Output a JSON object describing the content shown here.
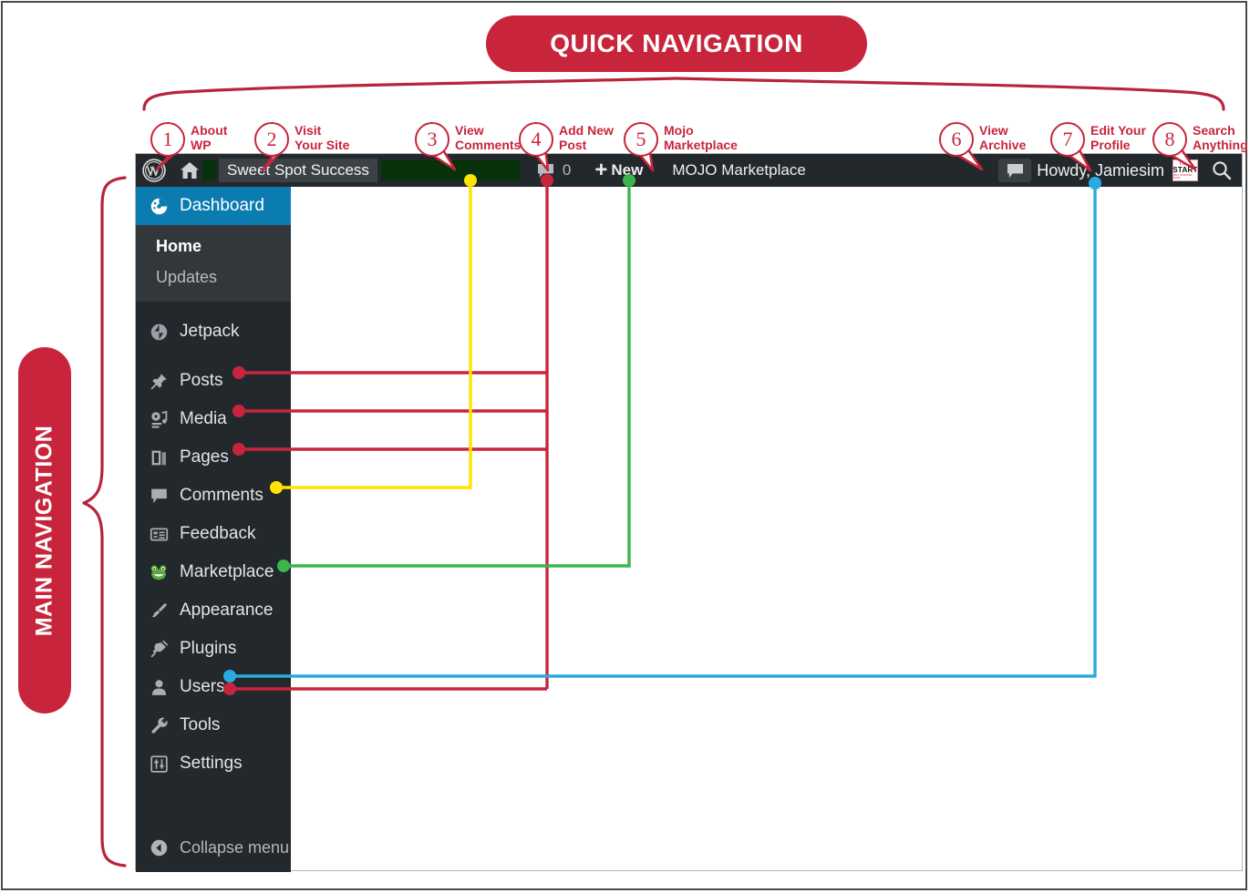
{
  "banners": {
    "quick_navigation": "QUICK NAVIGATION",
    "main_navigation": "MAIN NAVIGATION"
  },
  "colors": {
    "accent_red": "#c8253c",
    "admin_bar_bg": "#23282d",
    "sidebar_bg": "#23282d",
    "active_menu_blue": "#0b7cb0",
    "submenu_bg": "#32373c",
    "line_red": "#c8253c",
    "line_yellow": "#ffe400",
    "line_green": "#3cb54a",
    "line_blue": "#29abe2"
  },
  "callouts": [
    {
      "num": "1",
      "line1": "About",
      "line2": "WP"
    },
    {
      "num": "2",
      "line1": "Visit",
      "line2": "Your Site"
    },
    {
      "num": "3",
      "line1": "View",
      "line2": "Comments"
    },
    {
      "num": "4",
      "line1": "Add New",
      "line2": "Post"
    },
    {
      "num": "5",
      "line1": "Mojo",
      "line2": "Marketplace"
    },
    {
      "num": "6",
      "line1": "View",
      "line2": "Archive"
    },
    {
      "num": "7",
      "line1": "Edit Your",
      "line2": "Profile"
    },
    {
      "num": "8",
      "line1": "Search",
      "line2": "Anything"
    }
  ],
  "admin_bar": {
    "wp_logo_icon": "wordpress-logo-icon",
    "home_icon": "home-icon",
    "site_name": "Sweet Spot Success",
    "comments_icon": "comment-bubble-icon",
    "comments_count": "0",
    "new_plus_icon": "plus-icon",
    "new_label": "New",
    "mojo_label": "MOJO Marketplace",
    "archive_icon": "archive-bubble-icon",
    "howdy_label": "Howdy, Jamiesim",
    "start_logo": {
      "line1": "Click",
      "line2": "START",
      "line3": "GET STARTED NOW"
    },
    "search_icon": "search-icon"
  },
  "sidebar": {
    "items": [
      {
        "label": "Dashboard",
        "icon": "dashboard-icon",
        "active": true
      },
      {
        "label": "Jetpack",
        "icon": "jetpack-icon",
        "active": false
      },
      {
        "label": "Posts",
        "icon": "pin-icon",
        "active": false
      },
      {
        "label": "Media",
        "icon": "media-icon",
        "active": false
      },
      {
        "label": "Pages",
        "icon": "pages-icon",
        "active": false
      },
      {
        "label": "Comments",
        "icon": "comment-bubble-icon",
        "active": false
      },
      {
        "label": "Feedback",
        "icon": "feedback-icon",
        "active": false
      },
      {
        "label": "Marketplace",
        "icon": "mojo-frog-icon",
        "active": false
      },
      {
        "label": "Appearance",
        "icon": "paintbrush-icon",
        "active": false
      },
      {
        "label": "Plugins",
        "icon": "plug-icon",
        "active": false
      },
      {
        "label": "Users",
        "icon": "user-icon",
        "active": false
      },
      {
        "label": "Tools",
        "icon": "wrench-icon",
        "active": false
      },
      {
        "label": "Settings",
        "icon": "sliders-icon",
        "active": false
      }
    ],
    "submenu": [
      {
        "label": "Home",
        "current": true
      },
      {
        "label": "Updates",
        "current": false
      }
    ],
    "collapse": {
      "label": "Collapse menu",
      "icon": "collapse-arrow-icon"
    }
  }
}
